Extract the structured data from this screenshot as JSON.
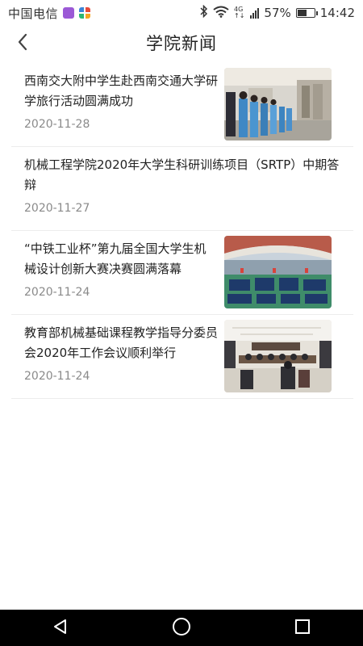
{
  "status_bar": {
    "carrier": "中国电信",
    "network": "4G",
    "battery": "57%",
    "battery_level": 0.57,
    "time": "14:42",
    "icons": [
      "app-icon",
      "grid-app-icon",
      "bluetooth-icon",
      "wifi-icon",
      "signal-icon",
      "battery-icon"
    ]
  },
  "header": {
    "title": "学院新闻",
    "back_icon": "chevron-left-icon"
  },
  "news": [
    {
      "title": "西南交大附中学生赴西南交通大学研学旅行活动圆满成功",
      "date": "2020-11-28",
      "thumbnail": "students-in-exhibition-hall-photo"
    },
    {
      "title": "机械工程学院2020年大学生科研训练项目（SRTP）中期答辩",
      "date": "2020-11-27",
      "thumbnail": null
    },
    {
      "title": "“中铁工业杯”第九届全国大学生机械设计创新大赛决赛圆满落幕",
      "date": "2020-11-24",
      "thumbnail": "stadium-ceremony-photo"
    },
    {
      "title": "教育部机械基础课程教学指导分委员会2020年工作会议顺利举行",
      "date": "2020-11-24",
      "thumbnail": "conference-room-photo"
    }
  ],
  "nav_bar": {
    "icons": [
      "back-triangle-icon",
      "home-circle-icon",
      "recents-square-icon"
    ]
  },
  "colors": {
    "background": "#ffffff",
    "title_text": "#222222",
    "date_text": "#8a8a8a",
    "divider": "#ececec",
    "nav_bar": "#000000"
  }
}
